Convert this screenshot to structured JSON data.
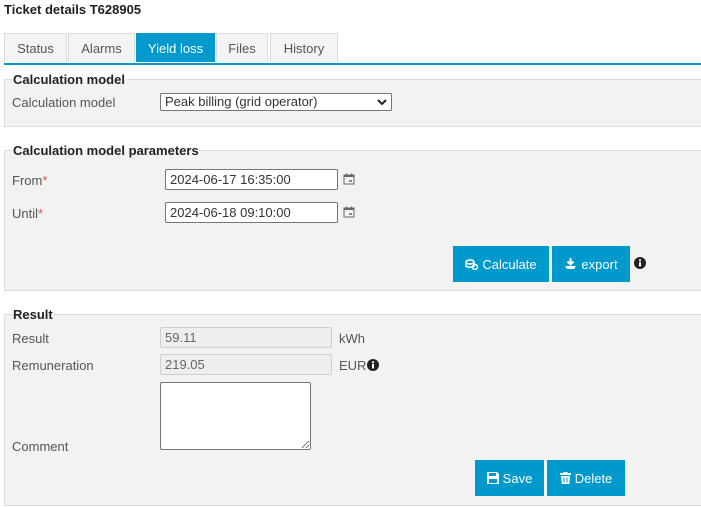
{
  "page": {
    "title": "Ticket details T628905"
  },
  "tabs": [
    {
      "label": "Status",
      "active": false
    },
    {
      "label": "Alarms",
      "active": false
    },
    {
      "label": "Yield loss",
      "active": true
    },
    {
      "label": "Files",
      "active": false
    },
    {
      "label": "History",
      "active": false
    }
  ],
  "calc_model": {
    "legend": "Calculation model",
    "label": "Calculation model",
    "selected": "Peak billing (grid operator)"
  },
  "params": {
    "legend": "Calculation model parameters",
    "from_label": "From",
    "from_value": "2024-06-17 16:35:00",
    "until_label": "Until",
    "until_value": "2024-06-18 09:10:00",
    "required_mark": "*",
    "calculate_label": "Calculate",
    "export_label": "export"
  },
  "result": {
    "legend": "Result",
    "result_label": "Result",
    "result_value": "59.11",
    "result_unit": "kWh",
    "remuneration_label": "Remuneration",
    "remuneration_value": "219.05",
    "remuneration_unit": "EUR",
    "comment_label": "Comment",
    "comment_value": "",
    "save_label": "Save",
    "delete_label": "Delete"
  },
  "colors": {
    "accent": "#0099cc",
    "panel": "#f2f2f2",
    "required": "#d9534f"
  }
}
